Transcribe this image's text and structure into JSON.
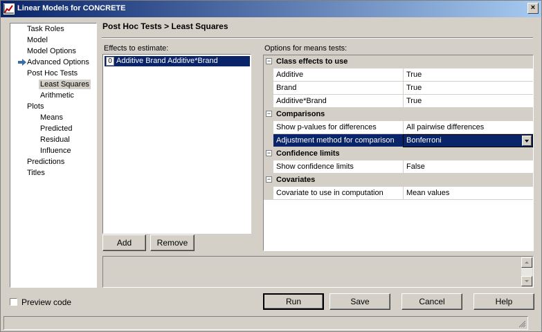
{
  "window": {
    "title": "Linear Models for CONCRETE",
    "close_label": "×"
  },
  "nav": {
    "items": [
      {
        "label": "Task Roles",
        "level": 0
      },
      {
        "label": "Model",
        "level": 0
      },
      {
        "label": "Model Options",
        "level": 0
      },
      {
        "label": "Advanced Options",
        "level": 0
      },
      {
        "label": "Post Hoc Tests",
        "level": 0
      },
      {
        "label": "Least Squares",
        "level": 1,
        "selected": true
      },
      {
        "label": "Arithmetic",
        "level": 1
      },
      {
        "label": "Plots",
        "level": 0
      },
      {
        "label": "Means",
        "level": 1
      },
      {
        "label": "Predicted",
        "level": 1
      },
      {
        "label": "Residual",
        "level": 1
      },
      {
        "label": "Influence",
        "level": 1
      },
      {
        "label": "Predictions",
        "level": 0
      },
      {
        "label": "Titles",
        "level": 0
      }
    ]
  },
  "page": {
    "title": "Post Hoc Tests > Least Squares"
  },
  "effects": {
    "label": "Effects to estimate:",
    "items": [
      {
        "index": "0",
        "text": "Additive Brand Additive*Brand"
      }
    ],
    "add_button": "Add",
    "remove_button": "Remove"
  },
  "options": {
    "label": "Options for means tests:",
    "collapse_symbol": "−",
    "categories": [
      {
        "name": "Class effects to use",
        "rows": [
          {
            "name": "Additive",
            "value": "True"
          },
          {
            "name": "Brand",
            "value": "True"
          },
          {
            "name": "Additive*Brand",
            "value": "True"
          }
        ]
      },
      {
        "name": "Comparisons",
        "rows": [
          {
            "name": "Show p-values for differences",
            "value": "All pairwise differences"
          },
          {
            "name": "Adjustment method for comparison",
            "value": "Bonferroni",
            "selected": true
          }
        ]
      },
      {
        "name": "Confidence limits",
        "rows": [
          {
            "name": "Show confidence limits",
            "value": "False"
          }
        ]
      },
      {
        "name": "Covariates",
        "rows": [
          {
            "name": "Covariate to use in computation",
            "value": "Mean values"
          }
        ]
      }
    ]
  },
  "footer": {
    "preview_code": "Preview code",
    "run": "Run",
    "save": "Save",
    "cancel": "Cancel",
    "help": "Help"
  },
  "colors": {
    "selection": "#0a246a",
    "face": "#d4d0c8"
  }
}
